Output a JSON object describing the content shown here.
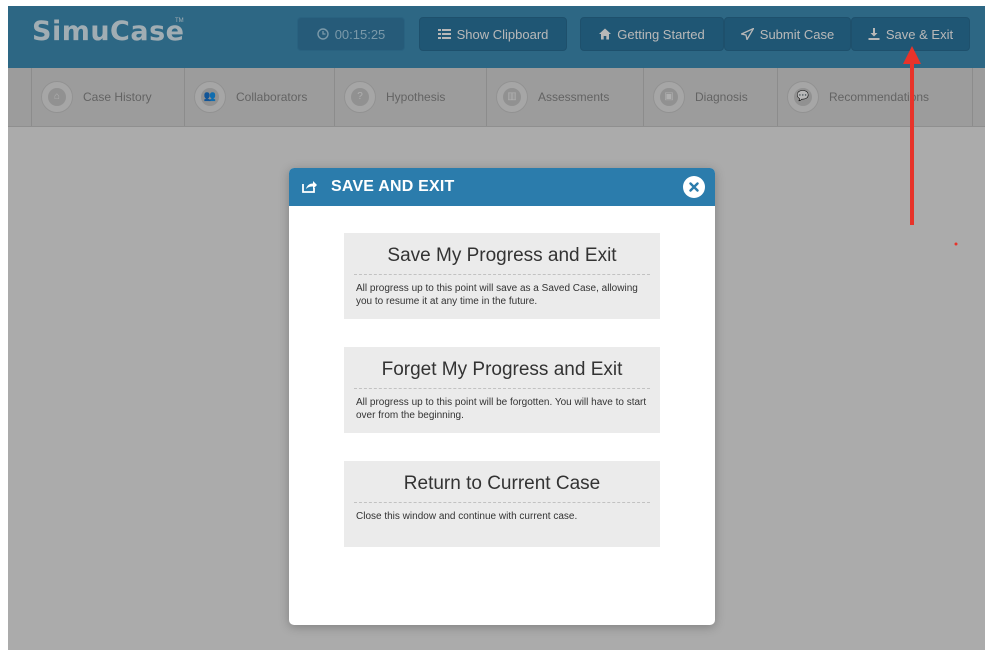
{
  "app": {
    "logo": "SimuCase",
    "logo_tm": "TM"
  },
  "header": {
    "timer": "00:15:25",
    "show_clipboard": "Show Clipboard",
    "getting_started": "Getting Started",
    "submit_case": "Submit Case",
    "save_exit": "Save & Exit"
  },
  "tabs": [
    {
      "label": "Case History",
      "icon": "home-icon"
    },
    {
      "label": "Collaborators",
      "icon": "users-icon"
    },
    {
      "label": "Hypothesis",
      "icon": "question-icon"
    },
    {
      "label": "Assessments",
      "icon": "chart-icon"
    },
    {
      "label": "Diagnosis",
      "icon": "briefcase-icon"
    },
    {
      "label": "Recommendations",
      "icon": "chat-icon"
    }
  ],
  "modal": {
    "title": "SAVE AND EXIT",
    "options": [
      {
        "title": "Save My Progress and Exit",
        "description": "All progress up to this point will save as a Saved Case, allowing you to resume it at any time in the future."
      },
      {
        "title": "Forget My Progress and Exit",
        "description": "All progress up to this point will be forgotten. You will have to start over from the beginning."
      },
      {
        "title": "Return to Current Case",
        "description": "Close this window and continue with current case."
      }
    ]
  },
  "colors": {
    "header": "#3f8fb8",
    "modal_header": "#2b7cac",
    "arrow": "#e8332a"
  }
}
